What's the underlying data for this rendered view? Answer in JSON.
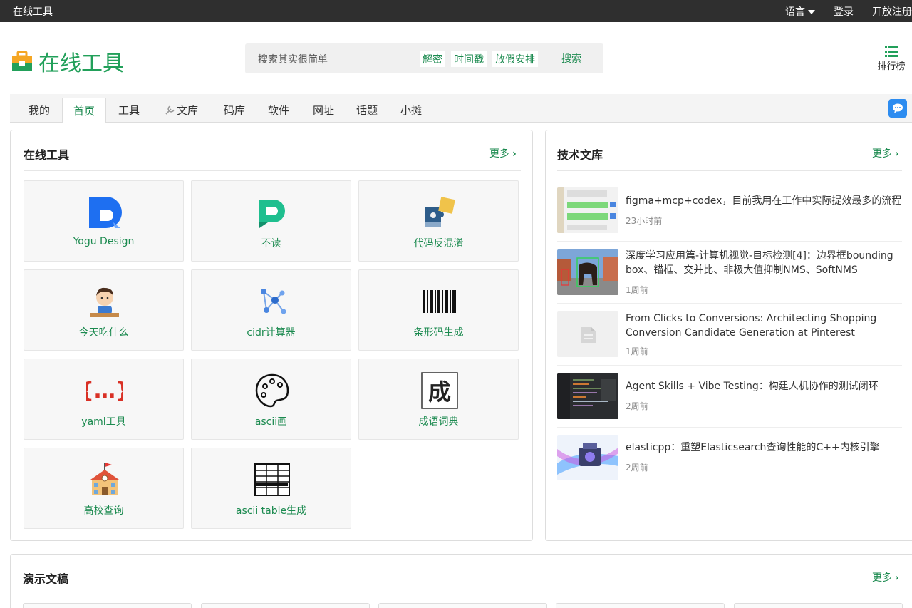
{
  "topbar": {
    "site": "在线工具",
    "language": "语言",
    "login": "登录",
    "register": "开放注册"
  },
  "header": {
    "logo_text": "在线工具",
    "search_placeholder": "搜索其实很简单",
    "chips": [
      "解密",
      "时间戳",
      "放假安排"
    ],
    "search_button": "搜索",
    "rank_label": "排行榜"
  },
  "nav": {
    "tabs": [
      "我的",
      "首页",
      "工具",
      "文库",
      "码库",
      "软件",
      "网址",
      "话题",
      "小摊"
    ],
    "active": "首页"
  },
  "tools_card": {
    "title": "在线工具",
    "more": "更多",
    "items": [
      {
        "label": "Yogu Design",
        "icon": "yogu-design-icon"
      },
      {
        "label": "不读",
        "icon": "budu-icon"
      },
      {
        "label": "代码反混淆",
        "icon": "puzzle-icon"
      },
      {
        "label": "今天吃什么",
        "icon": "eating-boy-icon"
      },
      {
        "label": "cidr计算器",
        "icon": "network-icon"
      },
      {
        "label": "条形码生成",
        "icon": "barcode-icon"
      },
      {
        "label": "yaml工具",
        "icon": "curly-braces-icon"
      },
      {
        "label": "ascii画",
        "icon": "palette-icon"
      },
      {
        "label": "成语词典",
        "icon": "cheng-character-icon"
      },
      {
        "label": "高校查询",
        "icon": "school-icon"
      },
      {
        "label": "ascii table生成",
        "icon": "table-icon"
      }
    ]
  },
  "articles_card": {
    "title": "技术文库",
    "more": "更多",
    "items": [
      {
        "title": "figma+mcp+codex，目前我用在工作中实际提效最多的流程",
        "time": "23小时前"
      },
      {
        "title": "深度学习应用篇-计算机视觉-目标检测[4]：边界框bounding box、锚框、交并比、非极大值抑制NMS、SoftNMS",
        "time": "1周前"
      },
      {
        "title": "From Clicks to Conversions: Architecting Shopping Conversion Candidate Generation at Pinterest",
        "time": "1周前"
      },
      {
        "title": "Agent Skills + Vibe Testing：构建人机协作的测试闭环",
        "time": "2周前"
      },
      {
        "title": "elasticpp：重塑Elasticsearch查询性能的C++内核引擎",
        "time": "2周前"
      }
    ]
  },
  "docs_card": {
    "title": "演示文稿",
    "more": "更多"
  },
  "colors": {
    "brand_green": "#22a05a",
    "link_green": "#1b8a4f",
    "topbar": "#2f2f2f",
    "chat_blue": "#2d8cf0"
  }
}
